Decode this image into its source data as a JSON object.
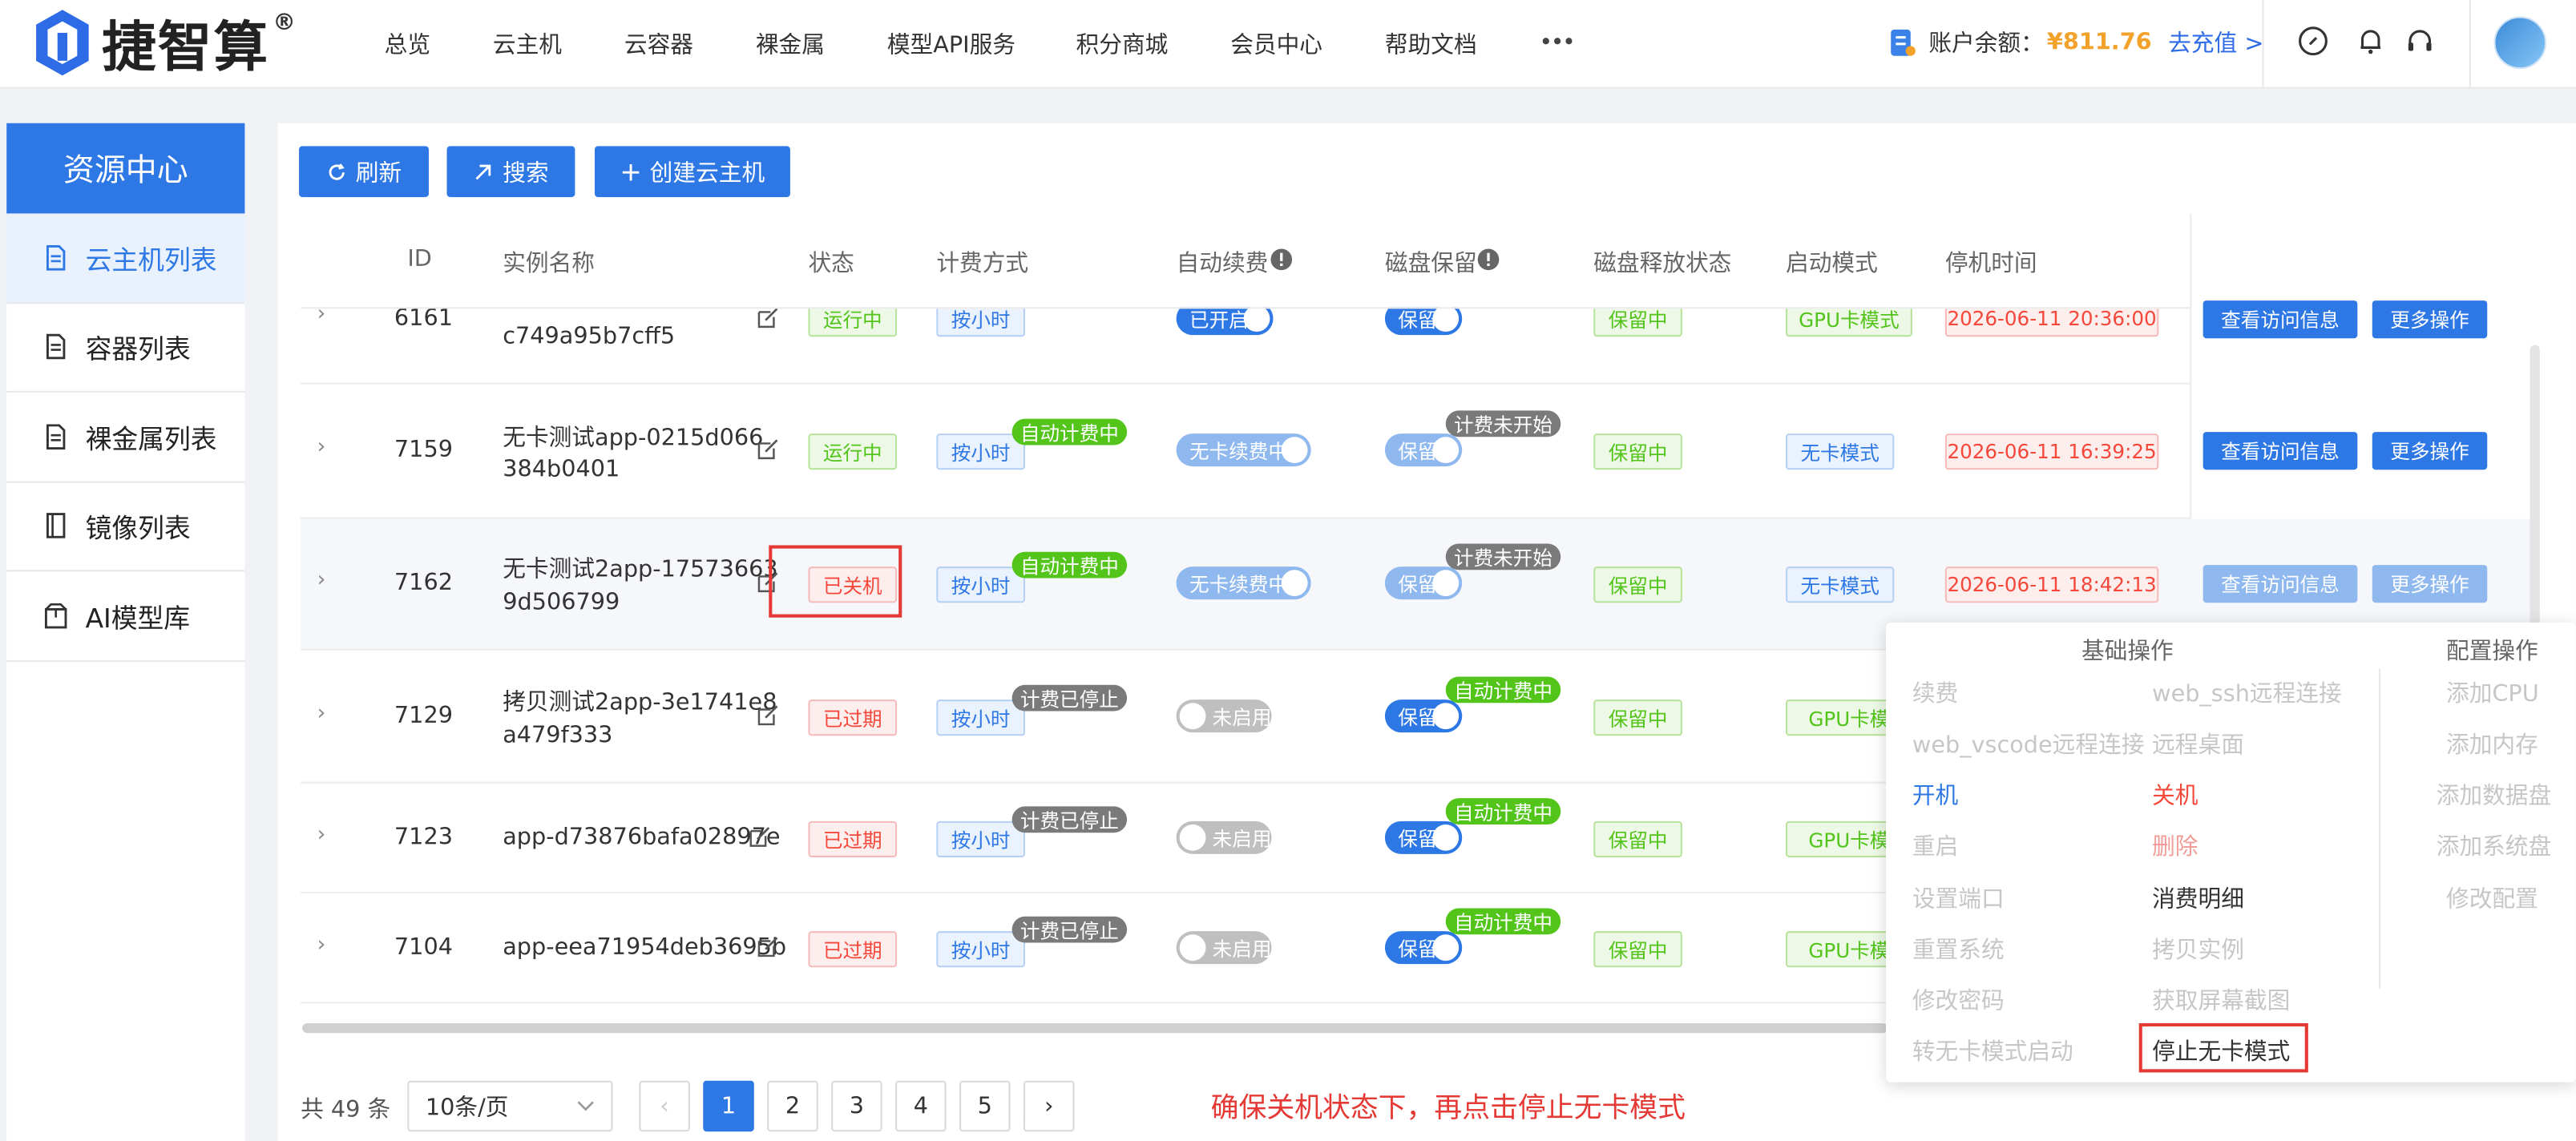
{
  "brand": {
    "name": "捷智算",
    "reg": "®"
  },
  "nav": [
    "总览",
    "云主机",
    "云容器",
    "裸金属",
    "模型API服务",
    "积分商城",
    "会员中心",
    "帮助文档"
  ],
  "account": {
    "label": "账户余额：",
    "value": "¥811.76",
    "recharge": "去充值 >"
  },
  "sidebar": {
    "title": "资源中心",
    "items": [
      {
        "label": "云主机列表",
        "icon": "document-icon"
      },
      {
        "label": "容器列表",
        "icon": "document-icon"
      },
      {
        "label": "裸金属列表",
        "icon": "document-icon"
      },
      {
        "label": "镜像列表",
        "icon": "notebook-icon"
      },
      {
        "label": "AI模型库",
        "icon": "package-icon"
      }
    ]
  },
  "toolbar": {
    "refresh": "刷新",
    "search": "搜索",
    "create": "创建云主机"
  },
  "columns": [
    "ID",
    "实例名称",
    "状态",
    "计费方式",
    "自动续费",
    "磁盘保留",
    "磁盘释放状态",
    "启动模式",
    "停机时间"
  ],
  "rows": [
    {
      "id": "6161",
      "name1": "",
      "name2": "c749a95b7cff5",
      "status": "运行中",
      "billing": "按小时",
      "renew": "已开启",
      "disk": "保留",
      "release": "保留中",
      "mode": "GPU卡模式",
      "time": "2026-06-11 20:36:00",
      "view": "查看访问信息",
      "more": "更多操作"
    },
    {
      "id": "7159",
      "name1": "无卡测试app-0215d066",
      "name2": "384b0401",
      "status": "运行中",
      "billing": "按小时",
      "bill_badge": "自动计费中",
      "renew": "无卡续费中",
      "disk": "保留",
      "disk_badge": "计费未开始",
      "release": "保留中",
      "mode": "无卡模式",
      "time": "2026-06-11 16:39:25",
      "view": "查看访问信息",
      "more": "更多操作"
    },
    {
      "id": "7162",
      "name1": "无卡测试2app-17573663",
      "name2": "9d506799",
      "status": "已关机",
      "billing": "按小时",
      "bill_badge": "自动计费中",
      "renew": "无卡续费中",
      "disk": "保留",
      "disk_badge": "计费未开始",
      "release": "保留中",
      "mode": "无卡模式",
      "time": "2026-06-11 18:42:13",
      "view": "查看访问信息",
      "more": "更多操作"
    },
    {
      "id": "7129",
      "name1": "拷贝测试2app-3e1741e8",
      "name2": "a479f333",
      "status": "已过期",
      "billing": "按小时",
      "bill_badge": "计费已停止",
      "renew": "未启用",
      "disk": "保留",
      "disk_badge": "自动计费中",
      "release": "保留中",
      "mode": "GPU卡模"
    },
    {
      "id": "7123",
      "name1": "app-d73876bafa02897e",
      "status": "已过期",
      "billing": "按小时",
      "bill_badge": "计费已停止",
      "renew": "未启用",
      "disk": "保留",
      "disk_badge": "自动计费中",
      "release": "保留中",
      "mode": "GPU卡模"
    },
    {
      "id": "7104",
      "name1": "app-eea71954deb3695b",
      "status": "已过期",
      "billing": "按小时",
      "bill_badge": "计费已停止",
      "renew": "未启用",
      "disk": "保留",
      "disk_badge": "自动计费中",
      "release": "保留中",
      "mode": "GPU卡模"
    }
  ],
  "menu": {
    "head_basic": "基础操作",
    "head_config": "配置操作",
    "col1": [
      "续费",
      "web_vscode远程连接",
      "开机",
      "重启",
      "设置端口",
      "重置系统",
      "修改密码",
      "转无卡模式启动"
    ],
    "col2": [
      "web_ssh远程连接",
      "远程桌面",
      "关机",
      "删除",
      "消费明细",
      "拷贝实例",
      "获取屏幕截图",
      "停止无卡模式"
    ],
    "col3": [
      "添加CPU",
      "添加内存",
      "添加数据盘",
      "添加系统盘",
      "修改配置"
    ]
  },
  "pagination": {
    "total": "共 49 条",
    "size": "10条/页",
    "pages": [
      "1",
      "2",
      "3",
      "4",
      "5"
    ],
    "current": "1"
  },
  "annotation": "确保关机状态下，再点击停止无卡模式"
}
